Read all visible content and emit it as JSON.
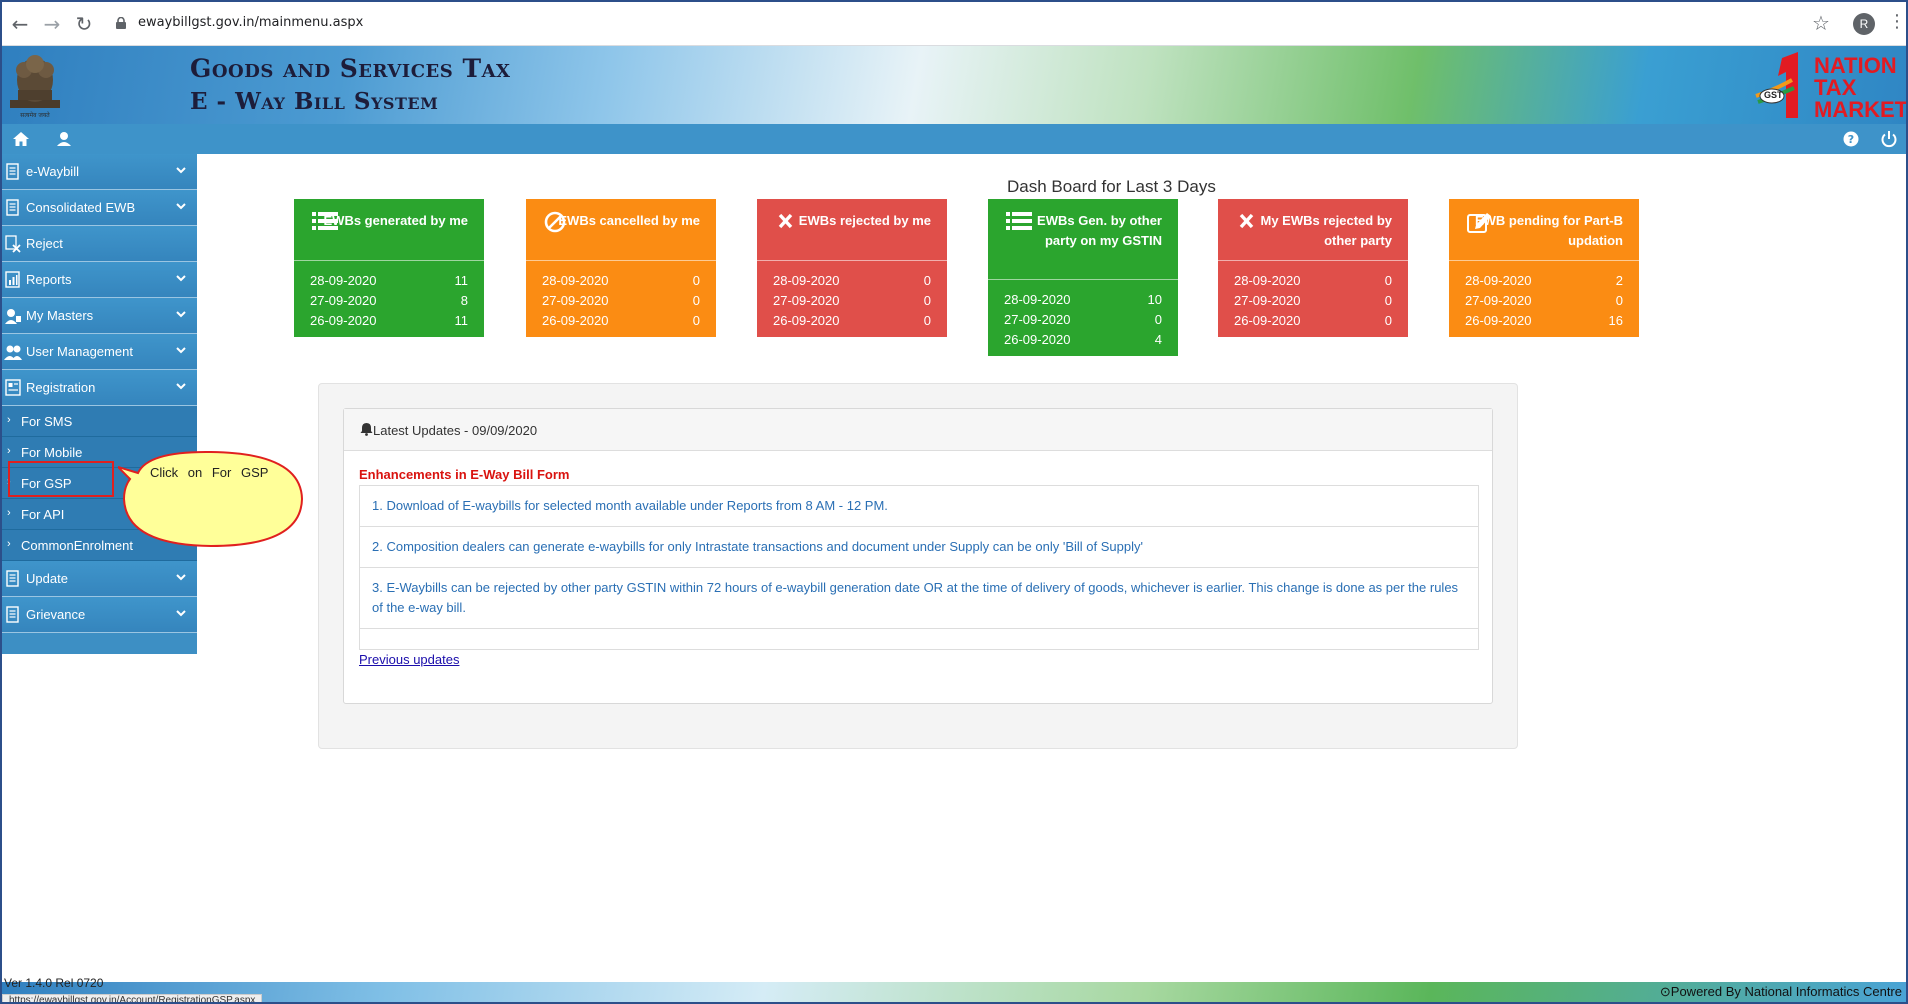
{
  "browser": {
    "url": "ewaybillgst.gov.in/mainmenu.aspx",
    "profile_initial": "R",
    "icons": [
      "back-icon",
      "forward-icon",
      "reload-icon",
      "lock-icon",
      "star-icon",
      "menu-icon"
    ]
  },
  "header": {
    "title_line1": "Goods and Services Tax",
    "title_line2": "E - Way Bill System",
    "emblem_caption": "सत्यमेव जयते",
    "logo_line1": "NATION",
    "logo_line2": "TAX",
    "logo_line3": "MARKET",
    "logo_badge": "GST"
  },
  "sidebar": {
    "items": [
      {
        "label": "e-Waybill",
        "icon": "document-icon",
        "expandable": true
      },
      {
        "label": "Consolidated EWB",
        "icon": "document-icon",
        "expandable": true
      },
      {
        "label": "Reject",
        "icon": "reject-icon",
        "expandable": false
      },
      {
        "label": "Reports",
        "icon": "report-icon",
        "expandable": true
      },
      {
        "label": "My Masters",
        "icon": "user-icon",
        "expandable": true
      },
      {
        "label": "User Management",
        "icon": "users-icon",
        "expandable": true
      },
      {
        "label": "Registration",
        "icon": "registration-icon",
        "expandable": true
      }
    ],
    "registration_sub": [
      "For SMS",
      "For Mobile",
      "For GSP",
      "For API",
      "CommonEnrolment"
    ],
    "items_after": [
      {
        "label": "Update",
        "icon": "document-icon",
        "expandable": true
      },
      {
        "label": "Grievance",
        "icon": "document-icon",
        "expandable": true
      }
    ],
    "sub_arrow": "›"
  },
  "callout": {
    "text": "Click on For GSP"
  },
  "dashboard": {
    "title": "Dash Board for Last 3 Days",
    "tiles": [
      {
        "title": "EWBs generated by me",
        "color": "#2ba52e",
        "icon": "list-icon",
        "rows": [
          {
            "date": "28-09-2020",
            "value": "11"
          },
          {
            "date": "27-09-2020",
            "value": "8"
          },
          {
            "date": "26-09-2020",
            "value": "11"
          }
        ]
      },
      {
        "title": "EWBs cancelled by me",
        "color": "#fb8c13",
        "icon": "ban-icon",
        "rows": [
          {
            "date": "28-09-2020",
            "value": "0"
          },
          {
            "date": "27-09-2020",
            "value": "0"
          },
          {
            "date": "26-09-2020",
            "value": "0"
          }
        ]
      },
      {
        "title": "EWBs rejected by me",
        "color": "#e04f4a",
        "icon": "close-icon",
        "rows": [
          {
            "date": "28-09-2020",
            "value": "0"
          },
          {
            "date": "27-09-2020",
            "value": "0"
          },
          {
            "date": "26-09-2020",
            "value": "0"
          }
        ]
      },
      {
        "title": "EWBs Gen. by other party on my GSTIN",
        "color": "#2ba52e",
        "icon": "list-icon",
        "rows": [
          {
            "date": "28-09-2020",
            "value": "10"
          },
          {
            "date": "27-09-2020",
            "value": "0"
          },
          {
            "date": "26-09-2020",
            "value": "4"
          }
        ]
      },
      {
        "title": "My EWBs rejected by other party",
        "color": "#e04f4a",
        "icon": "close-icon",
        "rows": [
          {
            "date": "28-09-2020",
            "value": "0"
          },
          {
            "date": "27-09-2020",
            "value": "0"
          },
          {
            "date": "26-09-2020",
            "value": "0"
          }
        ]
      },
      {
        "title": "EWB pending for Part-B updation",
        "color": "#fb8c13",
        "icon": "edit-icon",
        "rows": [
          {
            "date": "28-09-2020",
            "value": "2"
          },
          {
            "date": "27-09-2020",
            "value": "0"
          },
          {
            "date": "26-09-2020",
            "value": "16"
          }
        ]
      }
    ]
  },
  "updates": {
    "heading": "Latest Updates - 09/09/2020",
    "section_title": "Enhancements in E-Way Bill Form",
    "items": [
      "1. Download of E-waybills for selected month available under Reports from 8 AM - 12 PM.",
      "2. Composition dealers can generate e-waybills for only Intrastate transactions and document under Supply can be only 'Bill of Supply'",
      "3. E-Waybills can be rejected by other party GSTIN within 72 hours of e-waybill generation date OR at the time of delivery of goods, whichever is earlier. This change is done as per the rules of the e-way bill."
    ],
    "previous_link": "Previous updates"
  },
  "footer": {
    "powered_by": "Powered By National Informatics Centre",
    "version": "Ver 1.4.0 Rel 0720",
    "status_url": "https://ewaybillgst.gov.in/Account/RegistrationGSP.aspx"
  }
}
